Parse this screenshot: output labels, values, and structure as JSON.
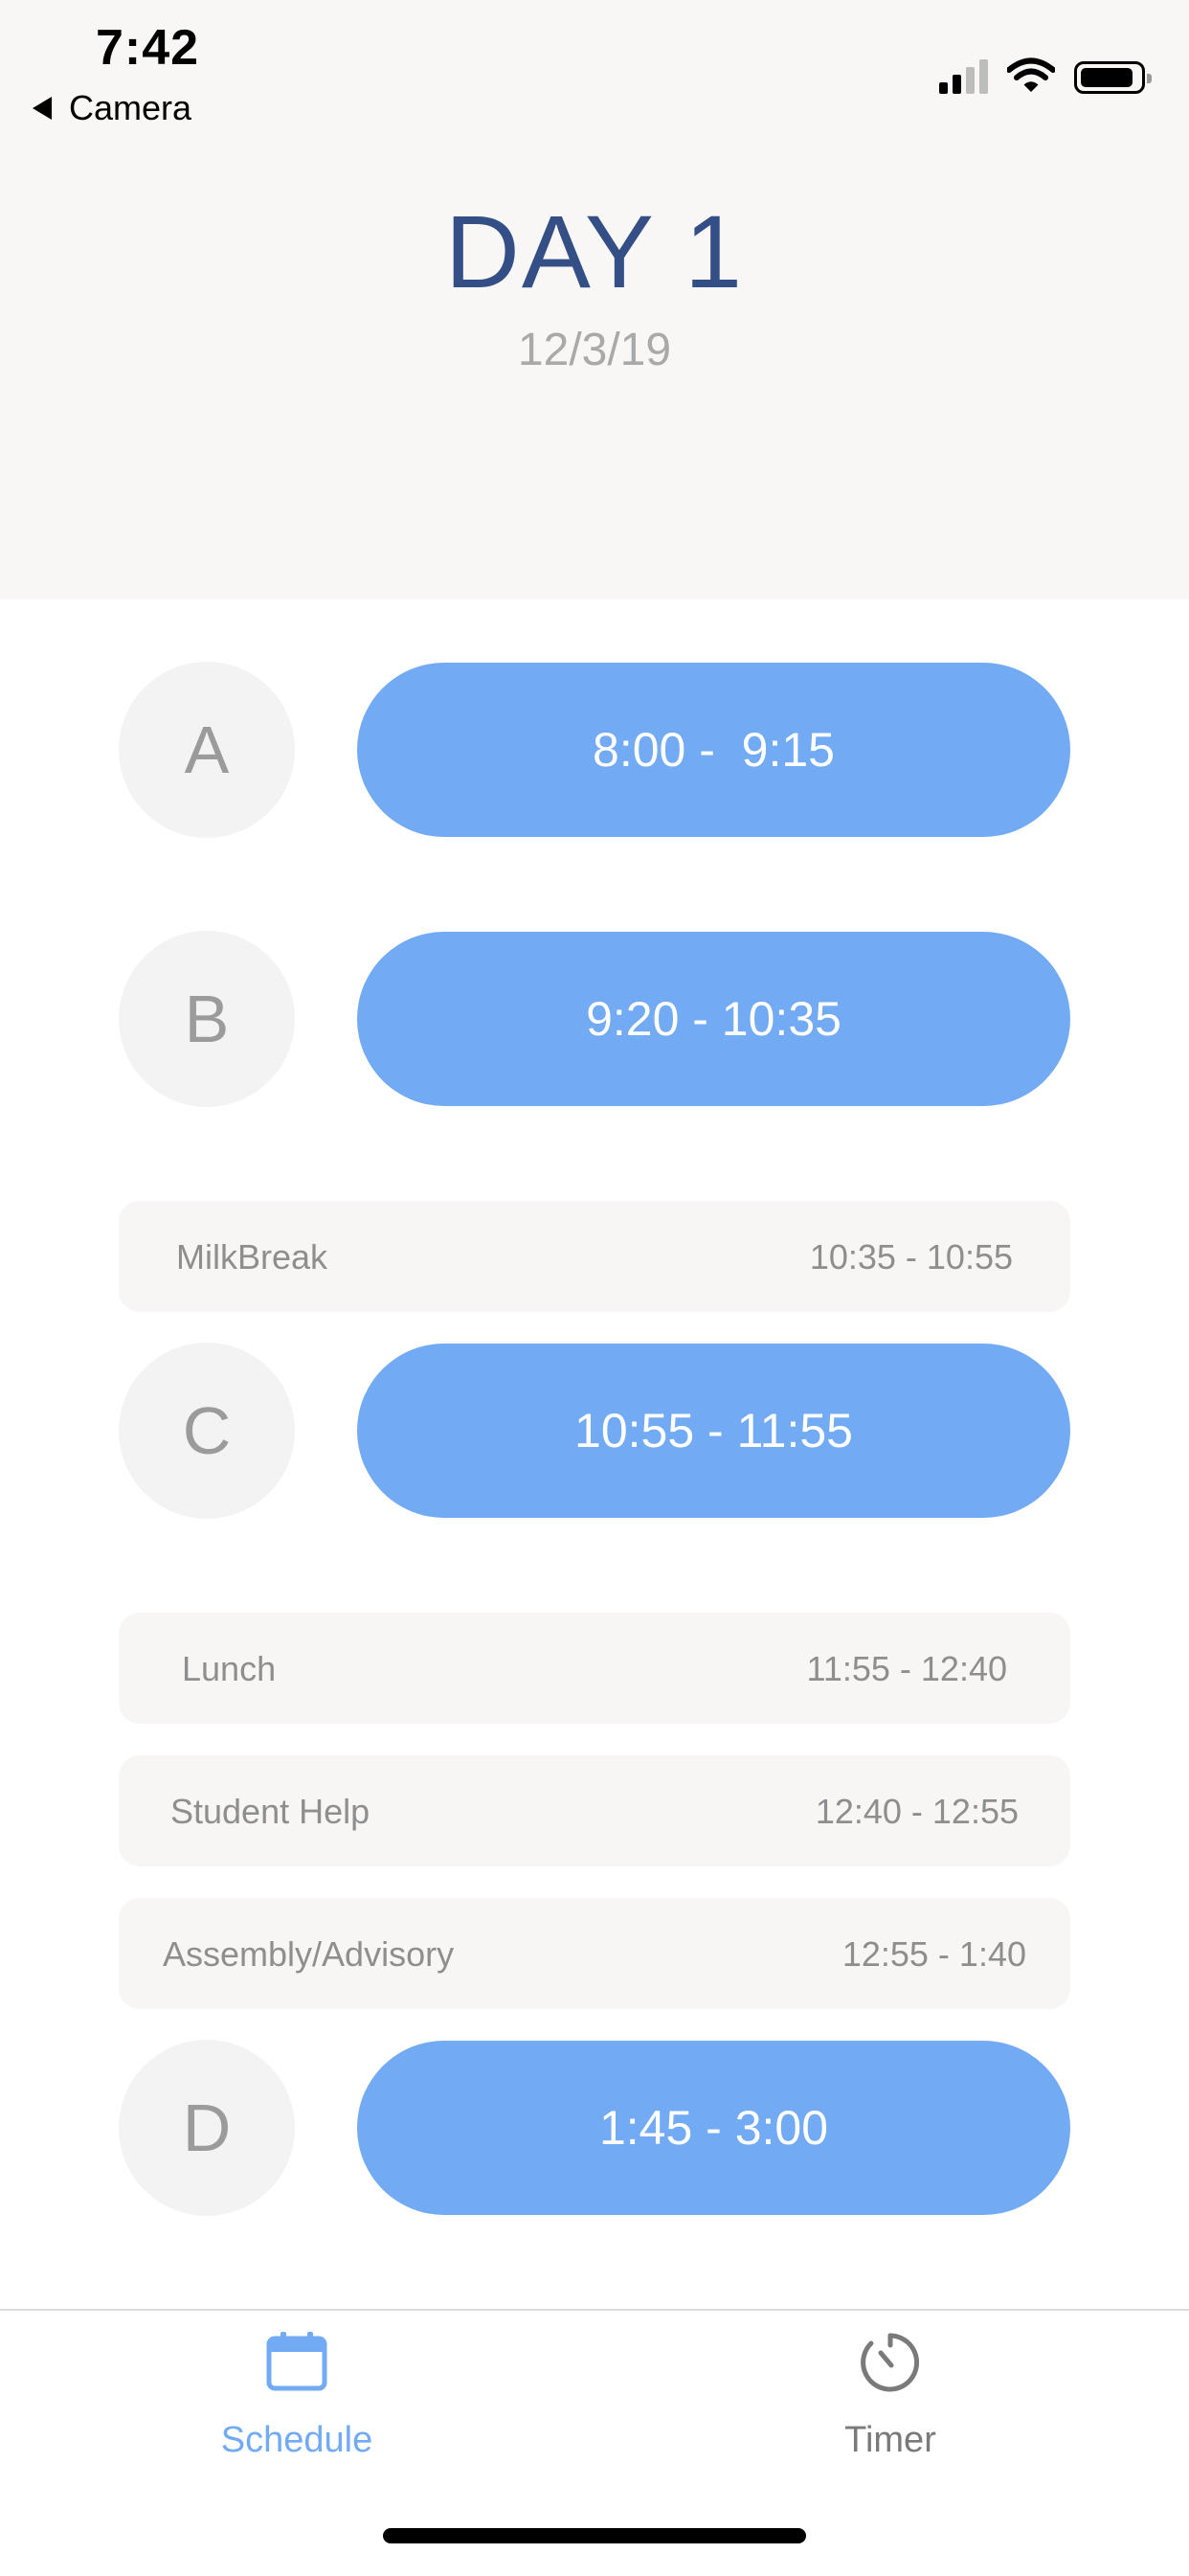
{
  "status_bar": {
    "time": "7:42",
    "back_label": "Camera"
  },
  "header": {
    "title": "DAY 1",
    "date": "12/3/19"
  },
  "colors": {
    "accent": "#72aaf4",
    "title": "#344f86",
    "tab_active": "#72aaf4",
    "tab_inactive": "#7a7a7a"
  },
  "periods": [
    {
      "letter": "A",
      "time": "8:00 -  9:15"
    },
    {
      "letter": "B",
      "time": "9:20 - 10:35"
    },
    {
      "letter": "C",
      "time": "10:55 - 11:55"
    },
    {
      "letter": "D",
      "time": "1:45 - 3:00"
    }
  ],
  "breaks": [
    {
      "name": "MilkBreak",
      "time": "10:35 - 10:55"
    },
    {
      "name": "Lunch",
      "time": "11:55 - 12:40"
    },
    {
      "name": "Student Help",
      "time": "12:40 - 12:55"
    },
    {
      "name": "Assembly/Advisory",
      "time": "12:55 - 1:40"
    }
  ],
  "tabs": [
    {
      "label": "Schedule",
      "icon": "calendar-icon",
      "active": true
    },
    {
      "label": "Timer",
      "icon": "timer-icon",
      "active": false
    }
  ]
}
